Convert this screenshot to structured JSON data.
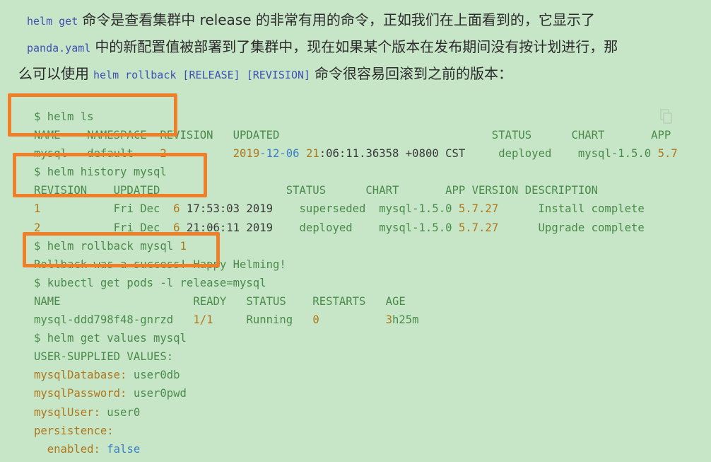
{
  "prose": {
    "code1": "helm get",
    "text1": "命令是查看集群中 release 的非常有用的命令，正如我们在上面看到的，它显示了",
    "code2": "panda.yaml",
    "text2": "中的新配置值被部署到了集群中，现在如果某个版本在发布期间没有按计划进行，那",
    "text3a": "么可以使用",
    "code3": "helm rollback [RELEASE] [REVISION]",
    "text3b": "命令很容易回滚到之前的版本："
  },
  "code_lines": [
    "$ helm ls",
    "NAME    NAMESPACE  REVISION   UPDATED                                STATUS      CHART       APP",
    "mysql   default    2          2019-12-06 21:06:11.36358 +0800 CST     deployed    mysql-1.5.0 5.7",
    "$ helm history mysql",
    "REVISION    UPDATED                   STATUS      CHART       APP VERSION DESCRIPTION",
    "1           Fri Dec  6 17:53:03 2019    superseded  mysql-1.5.0 5.7.27      Install complete",
    "2           Fri Dec  6 21:06:11 2019    deployed    mysql-1.5.0 5.7.27      Upgrade complete",
    "$ helm rollback mysql 1",
    "Rollback was a success! Happy Helming!",
    "$ kubectl get pods -l release=mysql",
    "NAME                    READY   STATUS    RESTARTS   AGE",
    "mysql-ddd798f48-gnrzd   1/1     Running   0          3h25m",
    "$ helm get values mysql",
    "USER-SUPPLIED VALUES:",
    "mysqlDatabase: user0db",
    "mysqlPassword: user0pwd",
    "mysqlUser: user0",
    "persistence:",
    "  enabled: false"
  ],
  "colors": {
    "background": "#c7e6c8",
    "highlight_box": "#f07f2a",
    "code_green": "#4a8a4a",
    "code_orange": "#b0771b",
    "code_blue": "#3b7fc7",
    "inline_code": "#3f51b5"
  },
  "icons": {
    "copy": "copy-icon"
  }
}
